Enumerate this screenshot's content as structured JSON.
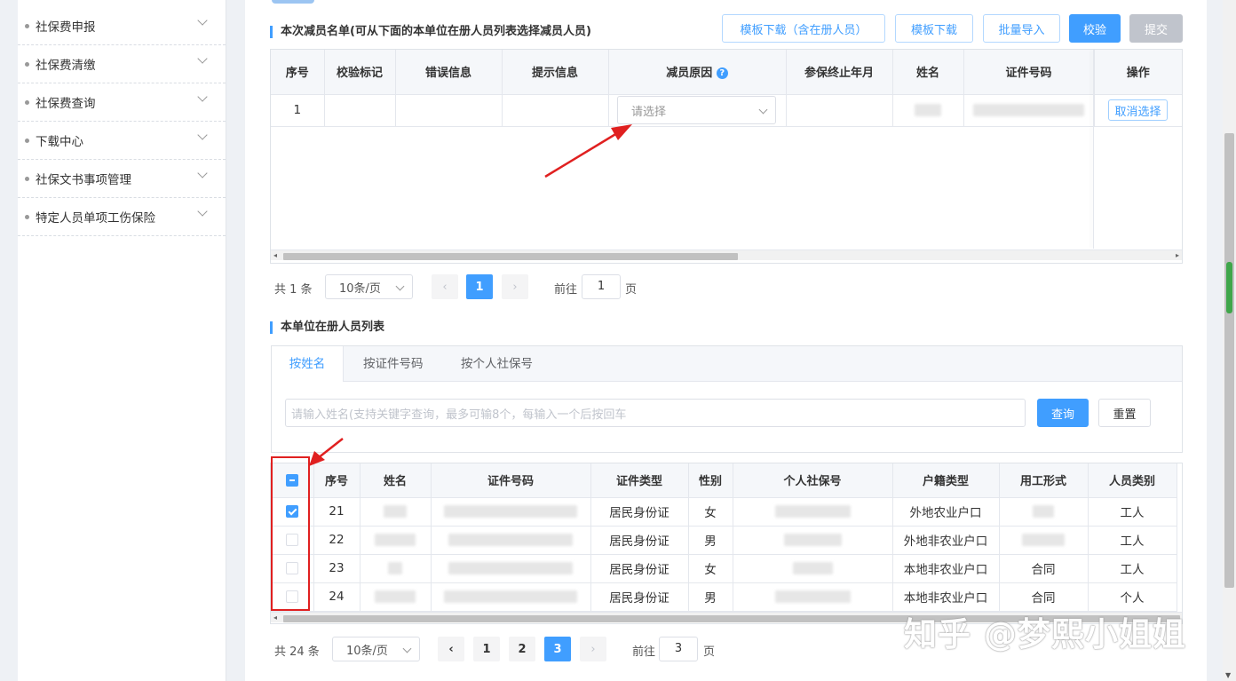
{
  "sidebar": {
    "items": [
      {
        "label": "社保费申报"
      },
      {
        "label": "社保费清缴"
      },
      {
        "label": "社保费查询"
      },
      {
        "label": "下载中心"
      },
      {
        "label": "社保文书事项管理"
      },
      {
        "label": "特定人员单项工伤保险"
      }
    ]
  },
  "reduce": {
    "title": "本次减员名单(可从下面的本单位在册人员列表选择减员人员)",
    "buttons": {
      "template_with": "模板下载（含在册人员）",
      "template": "模板下载",
      "batch_import": "批量导入",
      "validate": "校验",
      "submit": "提交"
    },
    "columns": [
      "序号",
      "校验标记",
      "错误信息",
      "提示信息",
      "减员原因",
      "参保终止年月",
      "姓名",
      "证件号码",
      "操作"
    ],
    "row": {
      "seq": "1",
      "reason_placeholder": "请选择",
      "action": "取消选择"
    },
    "pager": {
      "total": "共 1 条",
      "page_size": "10条/页",
      "current": "1",
      "goto_label": "前往",
      "goto_value": "1",
      "page_suffix": "页"
    }
  },
  "roster": {
    "title": "本单位在册人员列表",
    "tabs": [
      "按姓名",
      "按证件号码",
      "按个人社保号"
    ],
    "search_placeholder": "请输入姓名(支持关键字查询，最多可输8个，每输入一个后按回车",
    "query": "查询",
    "reset": "重置",
    "columns": [
      "序号",
      "姓名",
      "证件号码",
      "证件类型",
      "性别",
      "个人社保号",
      "户籍类型",
      "用工形式",
      "人员类别"
    ],
    "rows": [
      {
        "seq": "21",
        "id_type": "居民身份证",
        "gender": "女",
        "hukou": "外地农业户口",
        "employ": "",
        "category": "工人",
        "checked": true
      },
      {
        "seq": "22",
        "id_type": "居民身份证",
        "gender": "男",
        "hukou": "外地非农业户口",
        "employ": "",
        "category": "工人",
        "checked": false
      },
      {
        "seq": "23",
        "id_type": "居民身份证",
        "gender": "女",
        "hukou": "本地非农业户口",
        "employ": "合同",
        "category": "工人",
        "checked": false
      },
      {
        "seq": "24",
        "id_type": "居民身份证",
        "gender": "男",
        "hukou": "本地非农业户口",
        "employ": "合同",
        "category": "个人",
        "checked": false
      }
    ],
    "pager": {
      "total": "共 24 条",
      "page_size": "10条/页",
      "pages": [
        "1",
        "2",
        "3"
      ],
      "current": "3",
      "goto_label": "前往",
      "goto_value": "3",
      "page_suffix": "页"
    }
  },
  "watermark": "知乎 @梦熙小姐姐",
  "colors": {
    "accent": "#409eff",
    "annotation": "#e02020"
  }
}
